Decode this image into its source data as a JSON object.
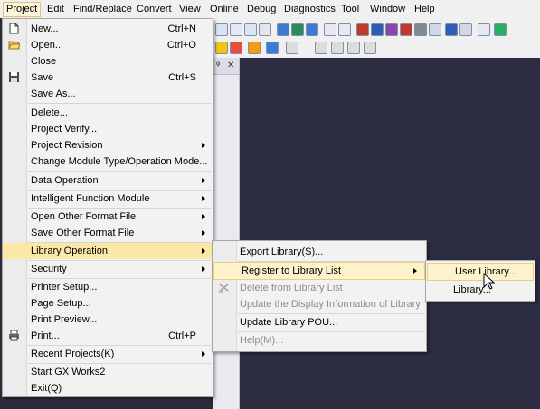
{
  "menubar": {
    "items": [
      "Project",
      "Edit",
      "Find/Replace",
      "Convert",
      "View",
      "Online",
      "Debug",
      "Diagnostics",
      "Tool",
      "Window",
      "Help"
    ]
  },
  "project_menu": {
    "items": [
      {
        "label": "New...",
        "shortcut": "Ctrl+N",
        "icon": "new-file-icon"
      },
      {
        "label": "Open...",
        "shortcut": "Ctrl+O",
        "icon": "open-folder-icon"
      },
      {
        "label": "Close",
        "shortcut": ""
      },
      {
        "label": "Save",
        "shortcut": "Ctrl+S",
        "icon": "save-icon"
      },
      {
        "label": "Save As...",
        "shortcut": ""
      },
      {
        "label": "Delete...",
        "shortcut": ""
      },
      {
        "label": "Project Verify...",
        "shortcut": ""
      },
      {
        "label": "Project Revision",
        "shortcut": "",
        "submenu": true
      },
      {
        "label": "Change Module Type/Operation Mode...",
        "shortcut": ""
      },
      {
        "label": "Data Operation",
        "shortcut": "",
        "submenu": true
      },
      {
        "label": "Intelligent Function Module",
        "shortcut": "",
        "submenu": true
      },
      {
        "label": "Open Other Format File",
        "shortcut": "",
        "submenu": true
      },
      {
        "label": "Save Other Format File",
        "shortcut": "",
        "submenu": true
      },
      {
        "label": "Library Operation",
        "shortcut": "",
        "submenu": true,
        "highlighted": true
      },
      {
        "label": "Security",
        "shortcut": "",
        "submenu": true
      },
      {
        "label": "Printer Setup...",
        "shortcut": ""
      },
      {
        "label": "Page Setup...",
        "shortcut": ""
      },
      {
        "label": "Print Preview...",
        "shortcut": ""
      },
      {
        "label": "Print...",
        "shortcut": "Ctrl+P",
        "icon": "printer-icon"
      },
      {
        "label": "Recent Projects(K)",
        "shortcut": "",
        "submenu": true
      },
      {
        "label": "Start GX Works2",
        "shortcut": ""
      },
      {
        "label": "Exit(Q)",
        "shortcut": ""
      }
    ]
  },
  "library_menu": {
    "items": [
      {
        "label": "Export Library(S)...",
        "enabled": true
      },
      {
        "label": "Register to Library List",
        "enabled": true,
        "submenu": true,
        "highlighted": true
      },
      {
        "label": "Delete from Library List",
        "enabled": false,
        "icon": "delete-library-icon"
      },
      {
        "label": "Update the Display Information of Library",
        "enabled": false
      },
      {
        "label": "Update Library POU...",
        "enabled": true
      },
      {
        "label": "Help(M)...",
        "enabled": false
      }
    ]
  },
  "register_menu": {
    "items": [
      {
        "label": "User Library...",
        "highlighted": true
      },
      {
        "label": "Library..."
      }
    ]
  },
  "panel": {
    "pin": "ᵠ",
    "close": "✕"
  }
}
